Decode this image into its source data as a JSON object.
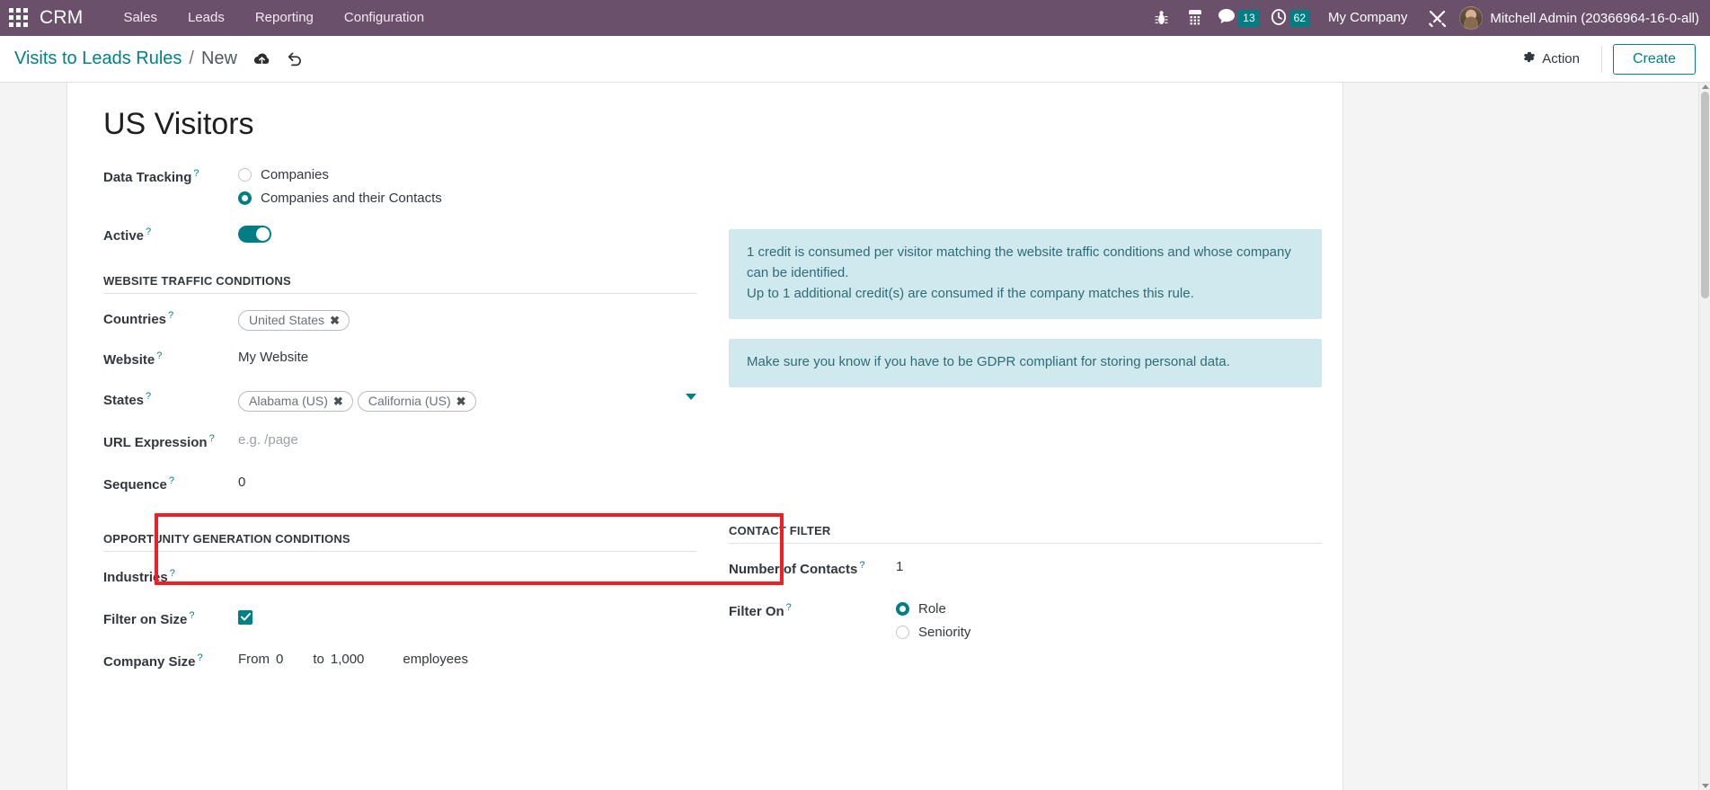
{
  "navbar": {
    "apps_icon": "apps-grid-icon",
    "brand": "CRM",
    "menu": [
      {
        "label": "Sales"
      },
      {
        "label": "Leads"
      },
      {
        "label": "Reporting"
      },
      {
        "label": "Configuration"
      }
    ],
    "icons": [
      {
        "name": "bug-icon"
      },
      {
        "name": "calculator-icon"
      }
    ],
    "messages": {
      "icon": "chat-bubble-icon",
      "count": "13"
    },
    "activities": {
      "icon": "clock-icon",
      "count": "62"
    },
    "company": "My Company",
    "tools_icon": "wrench-screwdriver-icon",
    "user": "Mitchell Admin (20366964-16-0-all)",
    "accent": "#6b506b",
    "badge_color": "#017e84"
  },
  "breadcrumb": {
    "parent": "Visits to Leads Rules",
    "separator": "/",
    "current": "New",
    "save_icon": "cloud-upload-icon",
    "discard_icon": "undo-icon"
  },
  "controlpanel": {
    "action_label": "Action",
    "action_icon": "gear-icon",
    "create_label": "Create"
  },
  "form": {
    "title": "US Visitors",
    "data_tracking": {
      "label": "Data Tracking",
      "options": [
        {
          "label": "Companies",
          "selected": false
        },
        {
          "label": "Companies and their Contacts",
          "selected": true
        }
      ]
    },
    "active": {
      "label": "Active",
      "value": "on"
    },
    "website_traffic": {
      "section": "WEBSITE TRAFFIC CONDITIONS",
      "countries": {
        "label": "Countries",
        "tags": [
          "United States"
        ]
      },
      "website": {
        "label": "Website",
        "value": "My Website"
      },
      "states": {
        "label": "States",
        "tags": [
          "Alabama (US)",
          "California (US)"
        ],
        "caret": "chevron-down-icon"
      },
      "url_expression": {
        "label": "URL Expression",
        "value": "",
        "placeholder": "e.g. /page"
      },
      "sequence": {
        "label": "Sequence",
        "value": "0"
      }
    },
    "opportunity": {
      "section": "OPPORTUNITY GENERATION CONDITIONS",
      "industries": {
        "label": "Industries",
        "tags": []
      },
      "filter_on_size": {
        "label": "Filter on Size",
        "checked": true
      },
      "company_size": {
        "label": "Company Size",
        "from_label": "From",
        "from_value": "0",
        "to_label": "to",
        "to_value": "1,000",
        "unit": "employees"
      }
    },
    "contact_filter": {
      "section": "CONTACT FILTER",
      "number_of_contacts": {
        "label": "Number of Contacts",
        "value": "1"
      },
      "filter_on": {
        "label": "Filter On",
        "options": [
          {
            "label": "Role",
            "selected": true
          },
          {
            "label": "Seniority",
            "selected": false
          }
        ]
      }
    },
    "alerts": [
      {
        "text": "1 credit is consumed per visitor matching the website traffic conditions and whose company can be identified.\nUp to 1 additional credit(s) are consumed if the company matches this rule."
      },
      {
        "text": "Make sure you know if you have to be GDPR compliant for storing personal data."
      }
    ]
  },
  "annotation": {
    "highlight_color": "#ee2027"
  }
}
